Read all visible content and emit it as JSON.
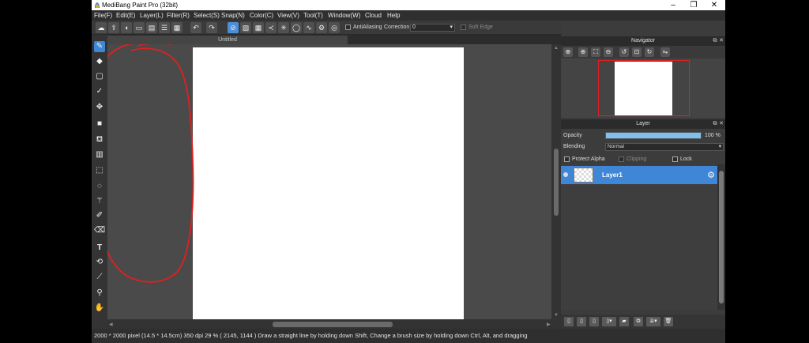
{
  "window": {
    "title": "MediBang Paint Pro (32bit)",
    "minimize": "–",
    "maximize": "❐",
    "close": "✕"
  },
  "menu": [
    "File(F)",
    "Edit(E)",
    "Layer(L)",
    "Filter(R)",
    "Select(S)",
    "Snap(N)",
    "Color(C)",
    "View(V)",
    "Tool(T)",
    "Window(W)",
    "Cloud",
    "Help"
  ],
  "toolbar": {
    "antialiasing_label": "AntiAliasing",
    "correction_label": "Correction",
    "correction_value": "0",
    "soft_edge_label": "Soft Edge"
  },
  "document_tab": "Untitled",
  "navigator": {
    "title": "Navigator"
  },
  "layer_panel": {
    "title": "Layer",
    "opacity_label": "Opacity",
    "opacity_value": "100 %",
    "opacity_fraction": 1.0,
    "blending_label": "Blending",
    "blending_value": "Normal",
    "protect_alpha_label": "Protect Alpha",
    "clipping_label": "Clipping",
    "lock_label": "Lock",
    "layers": [
      {
        "name": "Layer1"
      }
    ]
  },
  "status": "2000 * 2000 pixel   (14.5 * 14.5cm)   350 dpi   29 %   ( 2145, 1144 )   Draw a straight line by holding down Shift, Change a brush size by holding down Ctrl, Alt, and dragging",
  "colors": {
    "accent": "#3f86d6",
    "annotation": "#e02020",
    "opacity_bar": "#7fc0ee"
  }
}
